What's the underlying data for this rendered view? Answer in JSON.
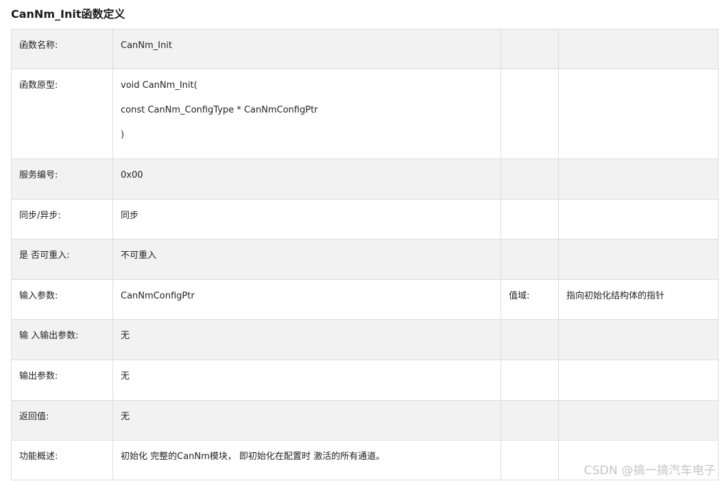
{
  "page": {
    "title": "CanNm_Init函数定义"
  },
  "rows": [
    {
      "label": "函数名称:",
      "value": "CanNm_Init",
      "c3": "",
      "c4": ""
    },
    {
      "label": "函数原型:",
      "value_lines": [
        "void CanNm_Init(",
        "const CanNm_ConfigType * CanNmConfigPtr",
        ")"
      ],
      "c3": "",
      "c4": ""
    },
    {
      "label": "服务编号:",
      "value": "0x00",
      "c3": "",
      "c4": ""
    },
    {
      "label": "同步/异步:",
      "value": "同步",
      "c3": "",
      "c4": ""
    },
    {
      "label": "是 否可重入:",
      "value": "不可重入",
      "c3": "",
      "c4": ""
    },
    {
      "label": "输入参数:",
      "value": "CanNmConfigPtr",
      "c3": "值域:",
      "c4": "指向初始化结构体的指针"
    },
    {
      "label": "输 入输出参数:",
      "value": "无",
      "c3": "",
      "c4": ""
    },
    {
      "label": "输出参数:",
      "value": "无",
      "c3": "",
      "c4": ""
    },
    {
      "label": "返回值:",
      "value": "无",
      "c3": "",
      "c4": ""
    },
    {
      "label": "功能概述:",
      "value": "初始化 完整的CanNm模块， 即初始化在配置时 激活的所有通道。",
      "c3": "",
      "c4": ""
    }
  ],
  "watermark": "CSDN @搞一搞汽车电子"
}
